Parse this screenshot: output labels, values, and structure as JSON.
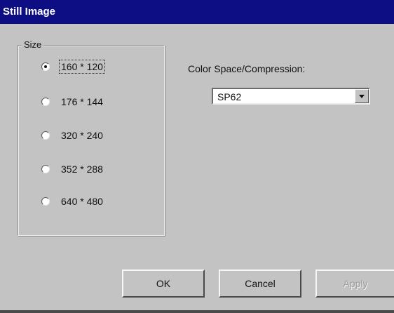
{
  "window": {
    "title": "Still Image",
    "title_bar_color": "#0e0e84",
    "background_color": "#c3c3c3"
  },
  "size_group": {
    "legend": "Size",
    "options": [
      {
        "label": "160 * 120",
        "selected": true
      },
      {
        "label": "176 * 144",
        "selected": false
      },
      {
        "label": "320 * 240",
        "selected": false
      },
      {
        "label": "352 * 288",
        "selected": false
      },
      {
        "label": "640 * 480",
        "selected": false
      }
    ]
  },
  "color_space": {
    "label": "Color Space/Compression:",
    "selected_value": "SP62",
    "icon": "chevron-down-icon"
  },
  "buttons": {
    "ok_label": "OK",
    "cancel_label": "Cancel",
    "apply_label": "Apply",
    "apply_disabled": true
  }
}
